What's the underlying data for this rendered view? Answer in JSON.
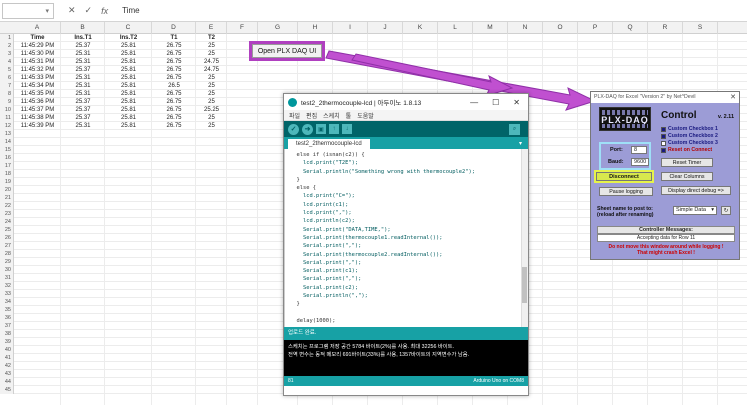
{
  "excel": {
    "name_box": "",
    "formula_icons": [
      "x-icon",
      "check-icon",
      "fx-icon"
    ],
    "formula_labels": [
      "✕",
      "✓",
      "fx"
    ],
    "formula_value": "Time",
    "columns": [
      "A",
      "B",
      "C",
      "D",
      "E",
      "F",
      "G",
      "H",
      "I",
      "J",
      "K",
      "L",
      "M",
      "N",
      "O",
      "P",
      "Q",
      "R",
      "S"
    ],
    "row_numbers": [
      "1",
      "2",
      "3",
      "4",
      "5",
      "6",
      "7",
      "8",
      "9",
      "10",
      "11",
      "12",
      "13",
      "14",
      "15",
      "16",
      "17",
      "18",
      "19",
      "20",
      "21",
      "22",
      "23",
      "24",
      "25",
      "26",
      "27",
      "28",
      "29",
      "30",
      "31",
      "32",
      "33",
      "34",
      "35",
      "36",
      "37",
      "38",
      "39",
      "40",
      "41",
      "42",
      "43",
      "44",
      "45"
    ],
    "headers": [
      "Time",
      "Ins.T1",
      "Ins.T2",
      "T1",
      "T2"
    ],
    "rows": [
      [
        "11:45:29 PM",
        "25.37",
        "25.81",
        "26.75",
        "25"
      ],
      [
        "11:45:30 PM",
        "25.31",
        "25.81",
        "26.75",
        "25"
      ],
      [
        "11:45:31 PM",
        "25.31",
        "25.81",
        "26.75",
        "24.75"
      ],
      [
        "11:45:32 PM",
        "25.37",
        "25.81",
        "26.75",
        "24.75"
      ],
      [
        "11:45:33 PM",
        "25.31",
        "25.81",
        "26.75",
        "25"
      ],
      [
        "11:45:34 PM",
        "25.31",
        "25.81",
        "26.5",
        "25"
      ],
      [
        "11:45:35 PM",
        "25.31",
        "25.81",
        "26.75",
        "25"
      ],
      [
        "11:45:36 PM",
        "25.37",
        "25.81",
        "26.75",
        "25"
      ],
      [
        "11:45:37 PM",
        "25.37",
        "25.81",
        "26.75",
        "25.25"
      ],
      [
        "11:45:38 PM",
        "25.37",
        "25.81",
        "26.75",
        "25"
      ],
      [
        "11:45:39 PM",
        "25.31",
        "25.81",
        "26.75",
        "25"
      ]
    ],
    "open_plx_button": "Open PLX DAQ UI"
  },
  "arduino": {
    "title": "test2_2thermocouple-lcd | 아두이노 1.8.13",
    "window_buttons": [
      "—",
      "☐",
      "✕"
    ],
    "menu": [
      "파일",
      "편집",
      "스케치",
      "툴",
      "도움말"
    ],
    "toolbar": {
      "verify_label": "✓",
      "upload_label": "➜",
      "new_label": "▣",
      "open_label": "↑",
      "save_label": "↓",
      "serial_label": "⌕"
    },
    "tab": "test2_2thermocouple-lcd",
    "tab_menu": "▾",
    "code": [
      "  else if (isnan(c2)) {",
      "    lcd.print(\"T2E\");",
      "    Serial.println(\"Something wrong with thermocouple2\");",
      "  }",
      "  else {",
      "    lcd.print(\"C=\");",
      "    lcd.print(c1);",
      "    lcd.print(\",\");",
      "    lcd.println(c2);",
      "    Serial.print(\"DATA,TIME,\");",
      "    Serial.print(thermocouple1.readInternal());",
      "    Serial.print(\",\");",
      "    Serial.print(thermocouple2.readInternal());",
      "    Serial.print(\",\");",
      "    Serial.print(c1);",
      "    Serial.print(\",\");",
      "    Serial.print(c2);",
      "    Serial.println(\",\");",
      "  }",
      "",
      "  delay(1000);"
    ],
    "status": "업로드 완료.",
    "console": [
      "스케치는 프로그램 저장 공간 5784 바이트(2%)를 사용. 최대 32256 바이트.",
      "전역 변수는 동적 메모리 691바이트(33%)를 사용, 1357바이트의 지역변수가 남음."
    ],
    "footer_left": "81",
    "footer_right": "Arduino Uno on COM8"
  },
  "plx": {
    "title": "PLX-DAQ for Excel \"Version 2\" by Net^Devil",
    "close": "✕",
    "logo": "PLX-DAQ",
    "control": "Control",
    "version": "v. 2.11",
    "checkboxes": [
      {
        "label": "Custom Checkbox 1",
        "checked": true
      },
      {
        "label": "Custom Checkbox 2",
        "checked": true
      },
      {
        "label": "Custom Checkbox 3",
        "checked": false
      },
      {
        "label": "Reset on Connect",
        "checked": true
      }
    ],
    "port_label": "Port:",
    "port_value": "8",
    "baud_label": "Baud:",
    "baud_value": "9600",
    "disconnect": "Disconnect",
    "pause_logging": "Pause logging",
    "reset_timer": "Reset Timer",
    "clear_columns": "Clear Columns",
    "display_debug": "Display direct debug =>",
    "sheet_label_1": "Sheet name to post to:",
    "sheet_label_2": "(reload after renaming)",
    "sheet_value": "Simple Data",
    "sheet_arrow": "▾",
    "sheet_reload": "↻",
    "messages_label": "Controller Messages:",
    "messages_value": "Accepting data for Row 11",
    "warning_1": "Do not move this window around while logging !",
    "warning_2": "That might crash Excel !"
  },
  "colors": {
    "highlight_purple": "#b040c0",
    "arduino_teal": "#00979c",
    "plx_background": "#9c9cd6",
    "disconnect_yellow": "#d8e84d",
    "port_highlight": "#9fe0f7"
  }
}
